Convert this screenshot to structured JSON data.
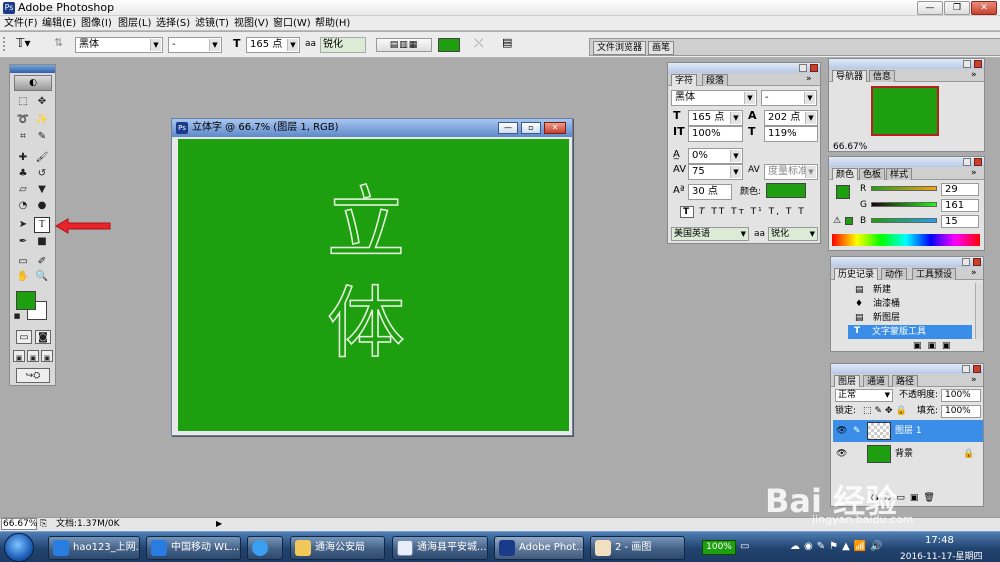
{
  "app": {
    "title": "Adobe Photoshop"
  },
  "menu": [
    "文件(F)",
    "编辑(E)",
    "图像(I)",
    "图层(L)",
    "选择(S)",
    "滤镜(T)",
    "视图(V)",
    "窗口(W)",
    "帮助(H)"
  ],
  "options_bar": {
    "font_family": "黑体",
    "font_style": "-",
    "font_size": "165 点",
    "aa_label": "a",
    "antialias": "锐化",
    "text_color": "#1d9f0f",
    "palette_tabs": [
      "文件浏览器",
      "画笔"
    ]
  },
  "document": {
    "title": "立体字 @ 66.7% (图层 1, RGB)",
    "canvas_color": "#1d9f0f",
    "text": [
      "立",
      "体"
    ]
  },
  "character_panel": {
    "tabs": [
      "字符",
      "段落"
    ],
    "font_family": "黑体",
    "font_style": "-",
    "font_size": "165 点",
    "leading": "202 点",
    "vertical_scale": "100%",
    "horizontal_scale": "119%",
    "kerning": "0%",
    "tracking": "75",
    "tracking_mode": "度量标准",
    "baseline_shift": "30 点",
    "color_label": "颜色:",
    "language": "美国英语",
    "aa_label": "a",
    "antialias": "锐化"
  },
  "navigator_panel": {
    "tabs": [
      "导航器",
      "信息"
    ],
    "zoom": "66.67%"
  },
  "color_panel": {
    "tabs": [
      "颜色",
      "色板",
      "样式"
    ],
    "r": "29",
    "g": "161",
    "b": "15",
    "r_label": "R",
    "g_label": "G",
    "b_label": "B"
  },
  "history_panel": {
    "tabs": [
      "历史记录",
      "动作",
      "工具预设"
    ],
    "items": [
      "新建",
      "油漆桶",
      "新图层",
      "文字蒙版工具"
    ]
  },
  "layers_panel": {
    "tabs": [
      "图层",
      "通道",
      "路径"
    ],
    "blend_mode": "正常",
    "opacity_label": "不透明度:",
    "opacity": "100%",
    "lock_label": "锁定:",
    "fill_label": "填充:",
    "fill": "100%",
    "layers": [
      "图层 1",
      "背景"
    ]
  },
  "status_bar": {
    "zoom": "66.67%",
    "doc_info": "文档:1.37M/0K"
  },
  "taskbar": {
    "tasks": [
      "hao123_上网...",
      "中国移动 WL...",
      "",
      "通海公安局",
      "通海县平安城...",
      "Adobe Phot...",
      "2 - 画图"
    ],
    "battery": "100%",
    "time": "17:48",
    "date": "2016-11-17-星期四"
  },
  "watermark": {
    "brand": "Bai 经验",
    "url": "jingyan.baidu.com"
  }
}
